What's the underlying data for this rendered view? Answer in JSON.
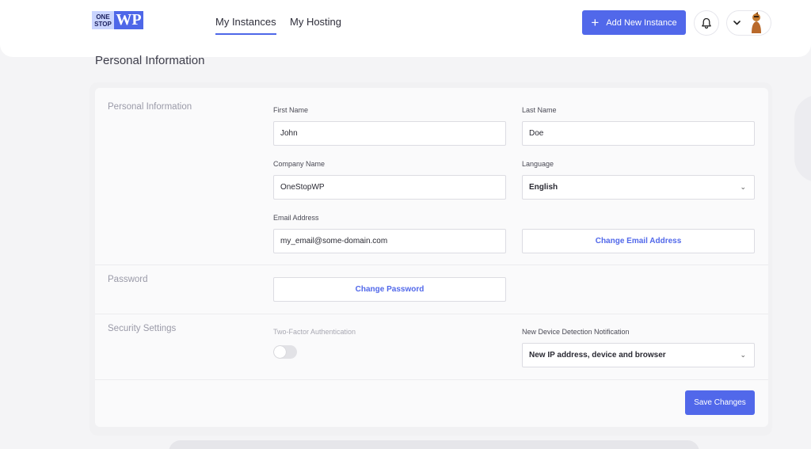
{
  "header": {
    "logo_small_top": "ONE",
    "logo_small_bottom": "STOP",
    "logo_big": "WP",
    "tabs": [
      {
        "label": "My Instances",
        "active": true
      },
      {
        "label": "My Hosting",
        "active": false
      }
    ],
    "add_button_label": "Add New Instance",
    "icons": {
      "bell": "bell-icon",
      "chevron": "chevron-down-icon",
      "plus": "plus-icon"
    }
  },
  "page": {
    "title": "Personal Information"
  },
  "personal_info": {
    "section_label": "Personal Information",
    "first_name_label": "First Name",
    "first_name_value": "John",
    "last_name_label": "Last Name",
    "last_name_value": "Doe",
    "company_label": "Company Name",
    "company_value": "OneStopWP",
    "language_label": "Language",
    "language_value": "English",
    "email_label": "Email Address",
    "email_value": "my_email@some-domain.com",
    "change_email_label": "Change Email Address"
  },
  "password": {
    "section_label": "Password",
    "change_password_label": "Change Password"
  },
  "security": {
    "section_label": "Security Settings",
    "two_factor_label": "Two-Factor Authentication",
    "two_factor_enabled": false,
    "detection_label": "New Device Detection Notification",
    "detection_value": "New IP address, device and browser"
  },
  "footer": {
    "save_label": "Save Changes"
  },
  "colors": {
    "accent": "#5168ea",
    "background": "#f4f4f6",
    "card": "#fafafb"
  }
}
